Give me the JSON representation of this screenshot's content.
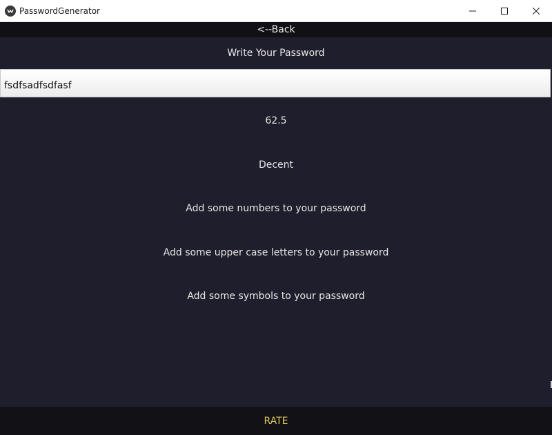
{
  "window": {
    "title": "PasswordGenerator",
    "app_icon": "app-logo-icon",
    "controls": [
      "minimize-icon",
      "maximize-icon",
      "close-icon"
    ]
  },
  "nav": {
    "back_label": "<--Back"
  },
  "form": {
    "prompt": "Write Your Password",
    "password_value": "fsdfsadfsdfasf"
  },
  "results": {
    "score": "62.5",
    "rating": "Decent",
    "suggestions": [
      "Add some numbers to your password",
      "Add some upper case letters to your password",
      "Add some symbols to your password"
    ]
  },
  "actions": {
    "rate_label": "RATE"
  },
  "colors": {
    "background": "#1f1e2c",
    "bar_background": "#111116",
    "accent": "#e3c45e",
    "text": "#e6e6e6"
  }
}
